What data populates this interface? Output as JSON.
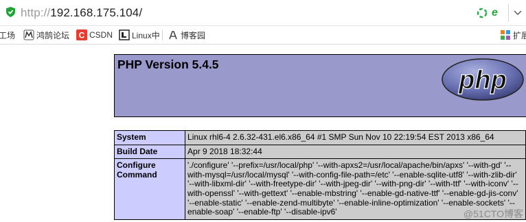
{
  "browser": {
    "url_protocol": "http://",
    "url_host": "192.168.175.104/"
  },
  "bookmarks": [
    {
      "label": "工场",
      "icon": "partial-icon"
    },
    {
      "label": "鸿鹄论坛",
      "icon": "hh-logo-icon"
    },
    {
      "label": "CSDN",
      "icon": "csdn-icon"
    },
    {
      "label": "Linux中",
      "icon": "linux-icon"
    },
    {
      "label": "博客园",
      "icon": "cnblogs-icon"
    },
    {
      "label": "扩展",
      "icon": "apps-icon"
    }
  ],
  "phpinfo": {
    "title": "PHP Version 5.4.5",
    "logo_text": "php",
    "rows": [
      {
        "key": "System",
        "value": "Linux rhl6-4 2.6.32-431.el6.x86_64 #1 SMP Sun Nov 10 22:19:54 EST 2013 x86_64"
      },
      {
        "key": "Build Date",
        "value": "Apr 9 2018 18:32:44"
      },
      {
        "key": "Configure Command",
        "value": "'./configure' '--prefix=/usr/local/php' '--with-apxs2=/usr/local/apache/bin/apxs' '--with-gd' '--with-mysql=/usr/local/mysql' '--with-config-file-path=/etc' '--enable-sqlite-utf8' '--with-zlib-dir' '--with-libxml-dir' '--with-freetype-dir' '--with-jpeg-dir' '--with-png-dir' '--with-ttf' '--with-iconv' '--with-openssl' '--with-gettext' '--enable-mbstring' '--enable-gd-native-ttf' '--enable-gd-jis-conv' '--enable-static' '--enable-zend-multibyte' '--enable-inline-optimization' '--enable-sockets' '--enable-soap' '--enable-ftp' '--disable-ipv6'"
      }
    ]
  },
  "watermark": "@51CTO博客",
  "colors": {
    "header_bg": "#9999cc",
    "key_bg": "#ccccff",
    "value_bg": "#cccccc"
  }
}
